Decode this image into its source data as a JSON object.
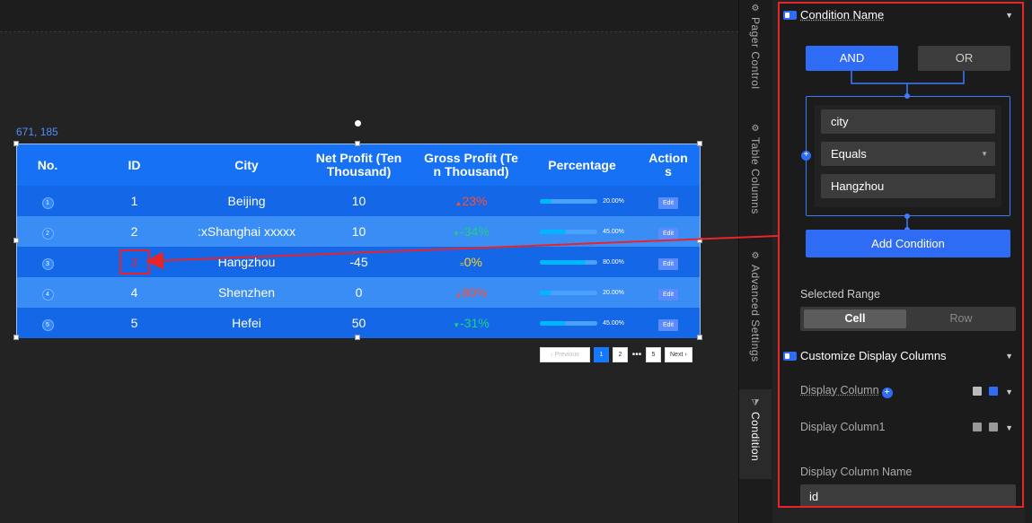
{
  "canvas": {
    "coord_readout": "671, 185"
  },
  "table": {
    "headers": [
      "No.",
      "ID",
      "City",
      "Net Profit (Ten Thousand)",
      "Gross Profit (Ten Thousand)",
      "Percentage",
      "Actions"
    ],
    "header_lines": {
      "net_profit": [
        "Net Profit (Ten",
        "Thousand)"
      ],
      "gross_profit": [
        "Gross Profit (Te",
        "n Thousand)"
      ],
      "actions": [
        "Action",
        "s"
      ]
    },
    "rows": [
      {
        "no": "1",
        "id": "1",
        "city": "Beijing",
        "net": "10",
        "gross": "23%",
        "trend": "up",
        "pct_label": "20.00%",
        "pct": 0.2,
        "action": "Edit"
      },
      {
        "no": "2",
        "id": "2",
        "city": ":xShanghai xxxxx",
        "net": "10",
        "gross": "-34%",
        "trend": "down",
        "pct_label": "45.00%",
        "pct": 0.45,
        "action": "Edit"
      },
      {
        "no": "3",
        "id": "3",
        "city": "Hangzhou",
        "net": "-45",
        "gross": "0%",
        "trend": "flat",
        "pct_label": "80.00%",
        "pct": 0.8,
        "action": "Edit"
      },
      {
        "no": "4",
        "id": "4",
        "city": "Shenzhen",
        "net": "0",
        "gross": "80%",
        "trend": "up",
        "pct_label": "20.00%",
        "pct": 0.2,
        "action": "Edit"
      },
      {
        "no": "5",
        "id": "5",
        "city": "Hefei",
        "net": "50",
        "gross": "-31%",
        "trend": "down",
        "pct_label": "45.00%",
        "pct": 0.45,
        "action": "Edit"
      }
    ]
  },
  "pager": {
    "previous": "Previous",
    "pages": [
      "1",
      "2",
      "5"
    ],
    "ellipsis": "•••",
    "next": "Next",
    "current": "1"
  },
  "vtabs": [
    {
      "label": "Pager Control"
    },
    {
      "label": "Table Columns"
    },
    {
      "label": "Advanced Settings"
    },
    {
      "label": "Condition"
    }
  ],
  "panel": {
    "condition_name_header": "Condition Name",
    "and_label": "AND",
    "or_label": "OR",
    "field_value": "city",
    "operator_value": "Equals",
    "compare_value": "Hangzhou",
    "add_condition": "Add Condition",
    "selected_range_label": "Selected Range",
    "range_cell": "Cell",
    "range_row": "Row",
    "customize_header": "Customize Display Columns",
    "display_column": "Display Column",
    "display_column1": "Display Column1",
    "display_column_name": "Display Column Name",
    "display_column_name_value": "id"
  },
  "colors": {
    "accent": "#2e6cf6",
    "table_header": "#1671f5",
    "highlight": "#e8242b",
    "up": "#ff4d2e",
    "down": "#19d37c",
    "flat": "#ffd21f"
  }
}
